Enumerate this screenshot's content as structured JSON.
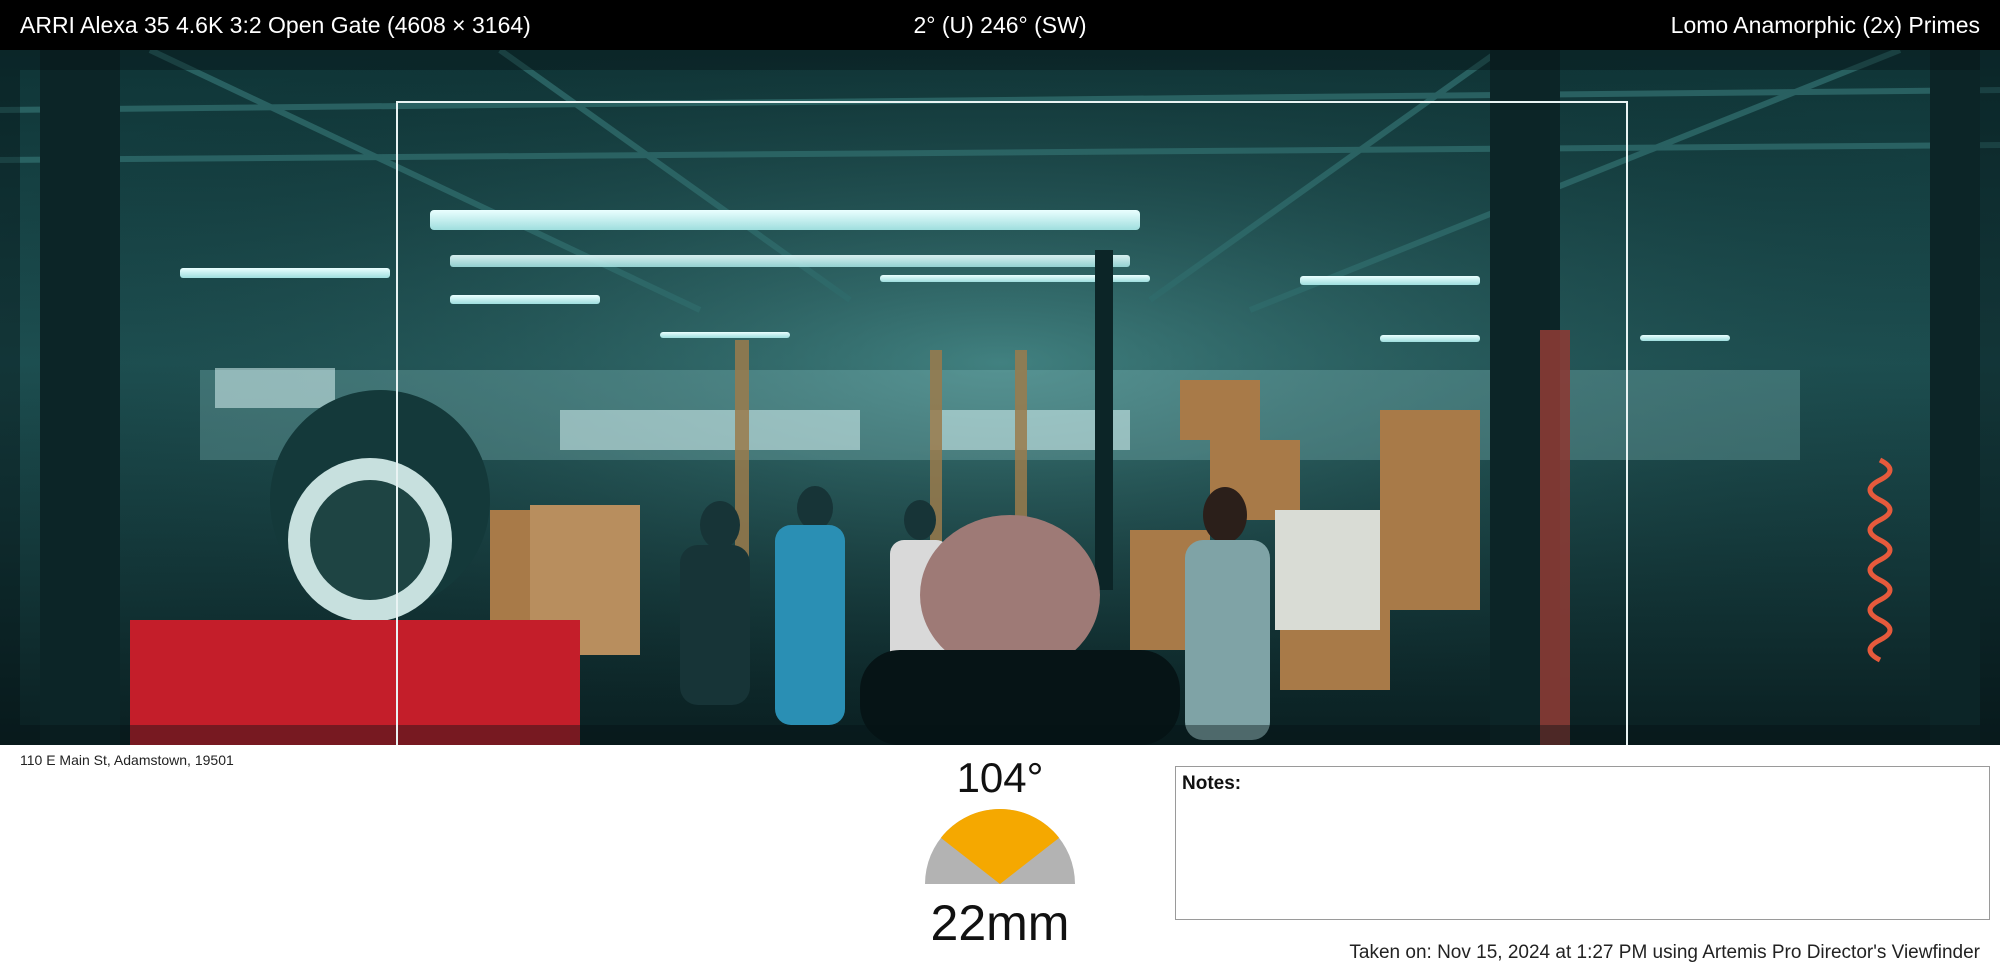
{
  "header": {
    "camera_format": "ARRI Alexa 35 4.6K 3:2 Open Gate (4608 × 3164)",
    "orientation": "2° (U) 246° (SW)",
    "lens_set": "Lomo Anamorphic (2x) Primes"
  },
  "viewfinder": {
    "scene_icon": "factory-warehouse-photo",
    "frame_guide_color": "#e9f3f3"
  },
  "footer": {
    "address": "110 E Main St, Adamstown, 19501",
    "fov_angle": "104°",
    "fov_fraction": 0.289,
    "gauge_accent_color": "#F5A800",
    "gauge_base_color": "#B3B3B3",
    "focal_length": "22mm",
    "notes_label": "Notes:",
    "notes_text": "",
    "taken_on": "Taken on: Nov 15, 2024 at 1:27 PM using Artemis Pro Director's Viewfinder"
  }
}
